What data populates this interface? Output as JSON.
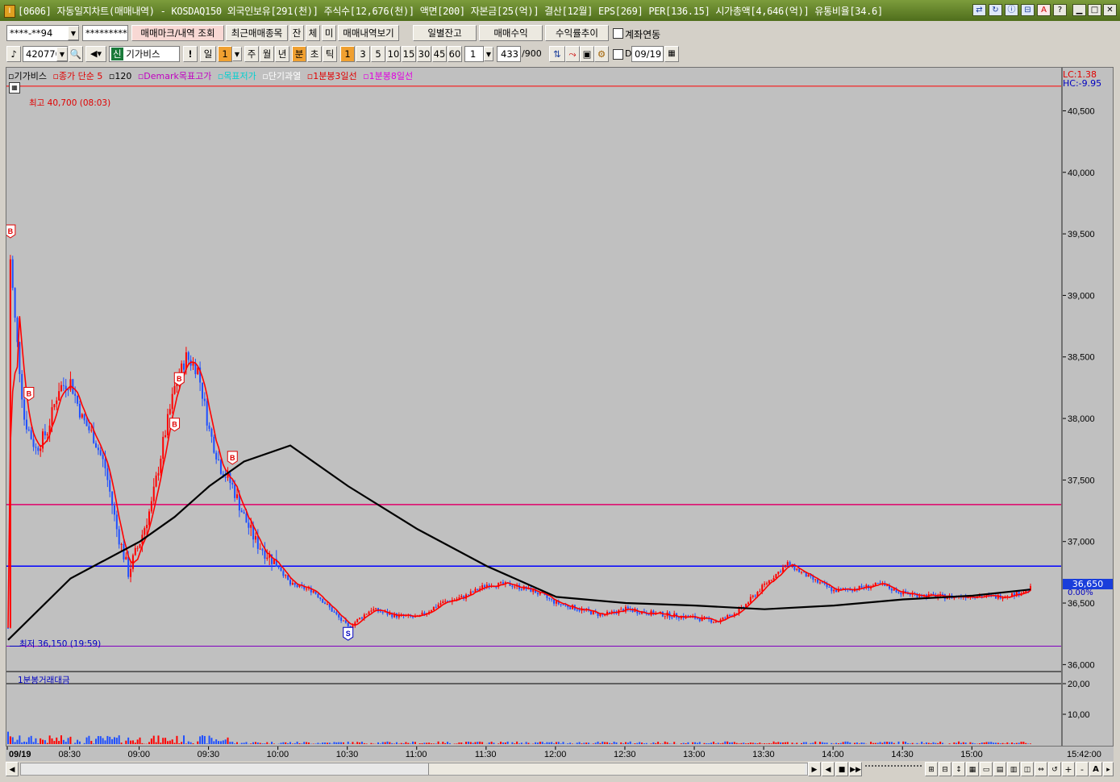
{
  "window": {
    "title": "[0606] 자동일지차트(매매내역) - KOSDAQ150 외국인보유[291(천)] 주식수[12,676(천)] 액면[200] 자본금[25(억)] 결산[12월] EPS[269] PER[136.15] 시가총액[4,646(억)] 유통비율[34.6]",
    "app_icon": "I"
  },
  "toolbar1": {
    "account": "****-**94",
    "password": "*********",
    "btn_trade_mark": "매매마크/내역 조회",
    "btn_recent": "최근매매종목",
    "btn_jan": "잔",
    "btn_che": "체",
    "btn_mi": "미",
    "btn_trade_view": "매매내역보기",
    "btn_daily": "일별잔고",
    "btn_profit": "매매수익",
    "btn_rate": "수익률추이",
    "chk_account": "계좌연동"
  },
  "toolbar2": {
    "code": "420770",
    "stock_tag": "신",
    "stock_name": "기가비스",
    "btn_excl": "!",
    "period_day": "일",
    "period_value": "1",
    "btn_week": "주",
    "btn_month": "월",
    "btn_year": "년",
    "btn_min": "분",
    "btn_sec": "초",
    "btn_tick": "틱",
    "minute_options": [
      "1",
      "3",
      "5",
      "10",
      "15",
      "30",
      "45",
      "60"
    ],
    "unit_value": "1",
    "count": "433",
    "count_max": "/900",
    "chk_d": "D",
    "date": "09/19"
  },
  "chart": {
    "legend": [
      {
        "text": "기가비스",
        "color": "#000000"
      },
      {
        "text": "종가 단순 5",
        "color": "#e00000"
      },
      {
        "text": "120",
        "color": "#000000"
      },
      {
        "text": "Demark목표고가",
        "color": "#c000c0"
      },
      {
        "text": "목표저가",
        "color": "#00d0d0"
      },
      {
        "text": "단기과열",
        "color": "#ffffff"
      },
      {
        "text": "1분봉3일선",
        "color": "#e00000"
      },
      {
        "text": "1분봉8일선",
        "color": "#e000e0"
      }
    ],
    "high_label": "최고 40,700 (08:03)",
    "low_label": "최저 36,150 (19:59)",
    "lc": "LC:1.38",
    "hc": "HC:-9.95",
    "current_price": "36,650",
    "current_pct": "0.00%",
    "volume_legend": "1분봉거래대금",
    "markers": [
      "B",
      "B",
      "B",
      "B",
      "B",
      "S"
    ]
  },
  "chart_data": {
    "type": "candlestick",
    "y_ticks": [
      "40,500",
      "40,000",
      "39,500",
      "39,000",
      "38,500",
      "38,000",
      "37,500",
      "37,000",
      "36,500",
      "36,000"
    ],
    "vol_ticks": [
      "20,00",
      "10,00"
    ],
    "x_ticks": [
      "09/19",
      "08:30",
      "09:00",
      "09:30",
      "10:00",
      "10:30",
      "11:00",
      "11:30",
      "12:00",
      "12:30",
      "13:00",
      "13:30",
      "14:00",
      "14:30",
      "15:00"
    ],
    "x_end": "15:42:00",
    "ylim": [
      35950,
      40850
    ],
    "hlines": {
      "high": 40700,
      "low": 36150,
      "demark_high": 37300,
      "demark_low": 36800
    },
    "ma5_color": "#ff0000",
    "ma120_color": "#000000",
    "price_path": [
      [
        "08:03",
        36300
      ],
      [
        "08:04",
        39300
      ],
      [
        "08:06",
        38800
      ],
      [
        "08:10",
        38000
      ],
      [
        "08:15",
        37750
      ],
      [
        "08:20",
        37900
      ],
      [
        "08:25",
        38250
      ],
      [
        "08:30",
        38300
      ],
      [
        "08:35",
        38000
      ],
      [
        "08:40",
        37850
      ],
      [
        "08:45",
        37600
      ],
      [
        "08:50",
        37100
      ],
      [
        "08:55",
        36750
      ],
      [
        "09:00",
        37000
      ],
      [
        "09:05",
        37300
      ],
      [
        "09:10",
        37800
      ],
      [
        "09:15",
        38250
      ],
      [
        "09:20",
        38500
      ],
      [
        "09:25",
        38400
      ],
      [
        "09:30",
        37900
      ],
      [
        "09:35",
        37600
      ],
      [
        "09:40",
        37450
      ],
      [
        "09:45",
        37200
      ],
      [
        "09:50",
        37000
      ],
      [
        "09:55",
        36900
      ],
      [
        "10:00",
        36800
      ],
      [
        "10:05",
        36650
      ],
      [
        "10:15",
        36600
      ],
      [
        "10:25",
        36400
      ],
      [
        "10:30",
        36300
      ],
      [
        "10:40",
        36450
      ],
      [
        "10:50",
        36400
      ],
      [
        "11:00",
        36380
      ],
      [
        "11:10",
        36500
      ],
      [
        "11:20",
        36550
      ],
      [
        "11:30",
        36650
      ],
      [
        "11:40",
        36650
      ],
      [
        "11:50",
        36600
      ],
      [
        "12:00",
        36500
      ],
      [
        "12:10",
        36450
      ],
      [
        "12:20",
        36400
      ],
      [
        "12:30",
        36450
      ],
      [
        "12:40",
        36420
      ],
      [
        "12:50",
        36400
      ],
      [
        "13:00",
        36380
      ],
      [
        "13:10",
        36350
      ],
      [
        "13:20",
        36450
      ],
      [
        "13:30",
        36650
      ],
      [
        "13:40",
        36820
      ],
      [
        "13:50",
        36700
      ],
      [
        "14:00",
        36600
      ],
      [
        "14:10",
        36620
      ],
      [
        "14:20",
        36650
      ],
      [
        "14:30",
        36580
      ],
      [
        "14:40",
        36560
      ],
      [
        "14:50",
        36550
      ],
      [
        "15:00",
        36560
      ],
      [
        "15:10",
        36550
      ],
      [
        "15:20",
        36580
      ],
      [
        "15:25",
        36620
      ]
    ],
    "ma120_path": [
      [
        "08:03",
        36200
      ],
      [
        "08:30",
        36700
      ],
      [
        "09:00",
        37000
      ],
      [
        "09:15",
        37200
      ],
      [
        "09:30",
        37450
      ],
      [
        "09:45",
        37650
      ],
      [
        "10:05",
        37780
      ],
      [
        "10:30",
        37450
      ],
      [
        "11:00",
        37100
      ],
      [
        "11:30",
        36800
      ],
      [
        "12:00",
        36550
      ],
      [
        "12:30",
        36500
      ],
      [
        "13:00",
        36480
      ],
      [
        "13:30",
        36450
      ],
      [
        "14:00",
        36480
      ],
      [
        "14:30",
        36530
      ],
      [
        "15:00",
        36560
      ],
      [
        "15:25",
        36610
      ]
    ]
  },
  "statusbar": {
    "nav": [
      "◀",
      "▶",
      "◀",
      "▮",
      "▶▶"
    ],
    "tools": [
      "⊞",
      "⊟",
      "↕",
      "+",
      "-",
      "A",
      "▸"
    ]
  }
}
